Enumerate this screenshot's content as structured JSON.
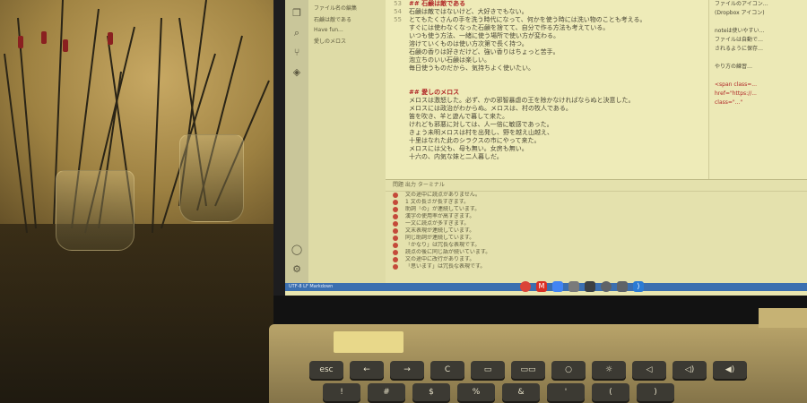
{
  "scene": {
    "description_icons": [
      "laptop",
      "branch-vases",
      "keyboard"
    ]
  },
  "editor": {
    "lines": [
      {
        "n": "53",
        "text": "## 石鹸は敵である",
        "heading": true
      },
      {
        "n": "54",
        "text": "石鹸は敵ではないけど、大好きでもない。",
        "heading": false
      },
      {
        "n": "55",
        "text": "とてもたくさんの手を洗う時代になって、何かを使う時には洗い物のことも考える。",
        "heading": false
      },
      {
        "n": "",
        "text": "すぐには使わなくなった石鹸を捨てて、自分で作る方法も考えている。",
        "heading": false
      },
      {
        "n": "",
        "text": "いつも使う方法、一緒に使う場所で使い方が変わる。",
        "heading": false
      },
      {
        "n": "",
        "text": "溶けていくものは使い方次第で長く持つ。",
        "heading": false
      },
      {
        "n": "",
        "text": "石鹸の香りは好きだけど、強い香りはちょっと苦手。",
        "heading": false
      },
      {
        "n": "",
        "text": "泡立ちのいい石鹸は楽しい。",
        "heading": false
      },
      {
        "n": "",
        "text": "毎日使うものだから、気持ちよく使いたい。",
        "heading": false
      },
      {
        "n": "",
        "text": "",
        "heading": false
      },
      {
        "n": "",
        "text": "",
        "heading": false
      },
      {
        "n": "",
        "text": "## 愛しのメロス",
        "heading": true
      },
      {
        "n": "",
        "text": "メロスは激怒した。必ず、かの邪智暴虐の王を除かなければならぬと決意した。",
        "heading": false
      },
      {
        "n": "",
        "text": "メロスには政治がわからぬ。メロスは、村の牧人である。",
        "heading": false
      },
      {
        "n": "",
        "text": "笛を吹き、羊と遊んで暮して来た。",
        "heading": false
      },
      {
        "n": "",
        "text": "けれども邪悪に対しては、人一倍に敏感であった。",
        "heading": false
      },
      {
        "n": "",
        "text": "きょう未明メロスは村を出発し、野を越え山越え、",
        "heading": false
      },
      {
        "n": "",
        "text": "十里はなれた此のシラクスの市にやって来た。",
        "heading": false
      },
      {
        "n": "",
        "text": "メロスには父も、母も無い。女房も無い。",
        "heading": false
      },
      {
        "n": "",
        "text": "十六の、内気な妹と二人暮しだ。",
        "heading": false
      }
    ]
  },
  "outline": {
    "items": [
      "ファイル名の編集",
      "石鹸は敵である",
      "Have fun...",
      "愛しのメロス"
    ]
  },
  "preview": {
    "lines": [
      {
        "text": "ファイルのアイコン…",
        "red": false
      },
      {
        "text": "(Dropbox アイコン)",
        "red": false
      },
      {
        "text": "",
        "red": false
      },
      {
        "text": "noteは使いやすい…",
        "red": false
      },
      {
        "text": "ファイルは自動で…",
        "red": false
      },
      {
        "text": "されるように保存…",
        "red": false
      },
      {
        "text": "",
        "red": false
      },
      {
        "text": "やり方の練習…",
        "red": false
      },
      {
        "text": "",
        "red": false
      },
      {
        "text": "<span class=...",
        "red": true
      },
      {
        "text": "href=\"https://...",
        "red": true
      },
      {
        "text": "class=\"...\"",
        "red": true
      }
    ]
  },
  "panel": {
    "tabs_label": "問題  出力  ターミナル",
    "problems": [
      "文の途中に読点がありません。",
      "1 文の長さが長すぎます。",
      "助詞「の」が連続しています。",
      "漢字の使用率が高すぎます。",
      "一文に読点が多すぎます。",
      "文末表現が連続しています。",
      "同じ助詞が連続しています。",
      "「かなり」は冗長な表現です。",
      "読点の後に同じ語が続いています。",
      "文の途中に改行があります。",
      "「思います」は冗長な表現です。"
    ]
  },
  "statusbar": {
    "text": "UTF-8  LF  Markdown"
  },
  "shelf": {
    "icons": [
      "chrome-icon",
      "gmail-icon",
      "docs-icon",
      "files-icon",
      "camera-icon",
      "settings-icon",
      "vscode-icon"
    ]
  },
  "keyboard": {
    "keys": [
      "esc",
      "←",
      "→",
      "C",
      "▭",
      "▭▭",
      "○",
      "☼",
      "◁",
      "◁)",
      "◀)",
      "!",
      "#",
      "$",
      "%",
      "&",
      "'",
      "(",
      ")"
    ]
  },
  "colors": {
    "screen_bg": "#e9e6b0",
    "heading": "#b02828",
    "status_bar": "#3b6fb0",
    "wall_glow": "#d4b36a"
  }
}
